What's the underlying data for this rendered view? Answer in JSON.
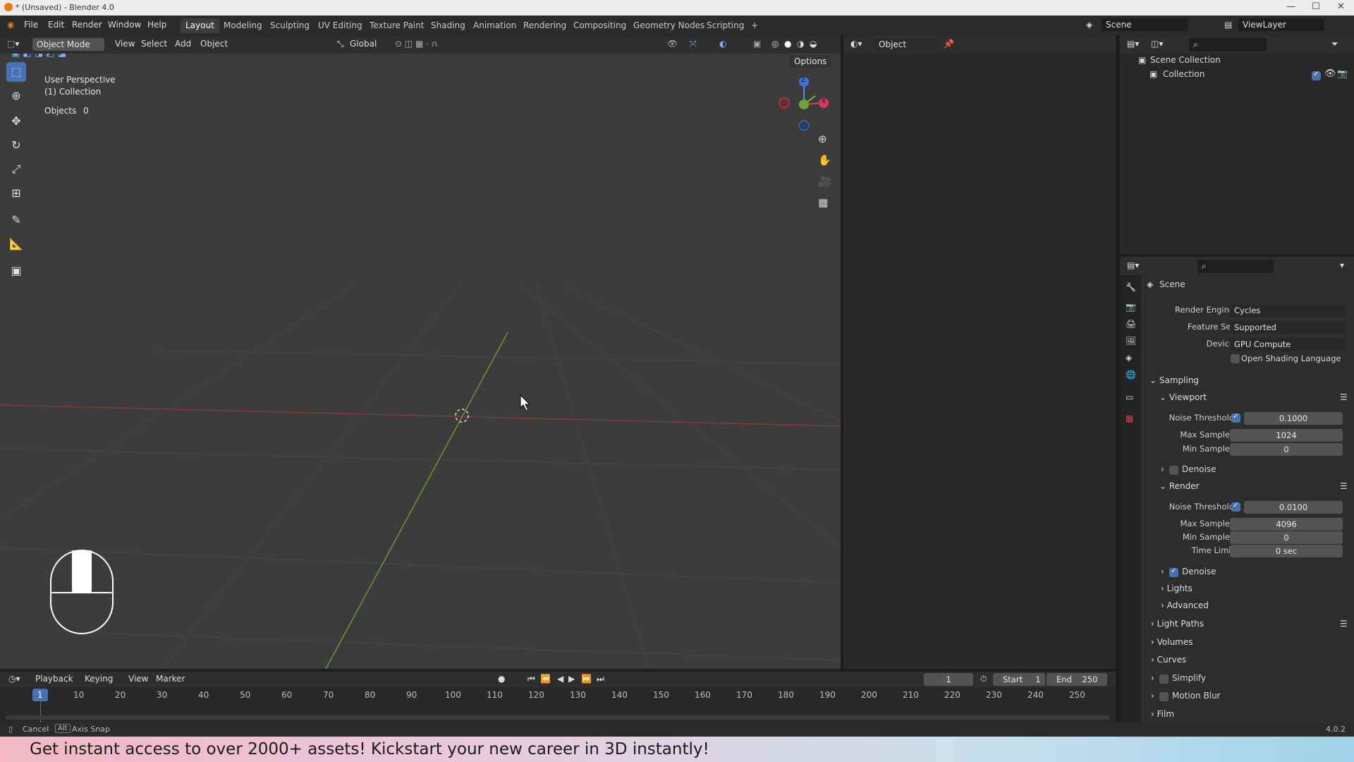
{
  "window": {
    "title": "* (Unsaved) - Blender 4.0",
    "controls": [
      "—",
      "☐",
      "✕"
    ]
  },
  "menu": [
    "File",
    "Edit",
    "Render",
    "Window",
    "Help"
  ],
  "workspaces": [
    "Layout",
    "Modeling",
    "Sculpting",
    "UV Editing",
    "Texture Paint",
    "Shading",
    "Animation",
    "Rendering",
    "Compositing",
    "Geometry Nodes",
    "Scripting",
    "+"
  ],
  "scene": {
    "name": "Scene",
    "view_layer": "ViewLayer"
  },
  "viewport": {
    "mode": "Object Mode",
    "menus": [
      "View",
      "Select",
      "Add",
      "Object"
    ],
    "transform": "Global",
    "options": "Options",
    "overlay_title": "User Perspective",
    "overlay_collection": "(1) Collection",
    "objects_label": "Objects",
    "objects_count": "0",
    "gizmo": {
      "z": "Z",
      "x": "X"
    }
  },
  "editor2": {
    "object_label": "Object"
  },
  "outliner": {
    "root": "Scene Collection",
    "child": "Collection"
  },
  "properties": {
    "header": "Scene",
    "render_engine_label": "Render Engine",
    "render_engine": "Cycles",
    "feature_set_label": "Feature Set",
    "feature_set": "Supported",
    "device_label": "Device",
    "device": "GPU Compute",
    "osl_label": "Open Shading Language",
    "sampling": "Sampling",
    "viewport": "Viewport",
    "noise_threshold_label": "Noise Threshold",
    "max_samples_label": "Max Samples",
    "min_samples_label": "Min Samples",
    "time_limit_label": "Time Limit",
    "vp_noise": "0.1000",
    "vp_max": "1024",
    "vp_min": "0",
    "denoise": "Denoise",
    "render": "Render",
    "r_noise": "0.0100",
    "r_max": "4096",
    "r_min": "0",
    "r_time": "0 sec",
    "lights": "Lights",
    "advanced": "Advanced",
    "light_paths": "Light Paths",
    "volumes": "Volumes",
    "curves": "Curves",
    "simplify": "Simplify",
    "motion_blur": "Motion Blur",
    "film": "Film"
  },
  "timeline": {
    "menus": [
      "Playback",
      "Keying",
      "View",
      "Marker"
    ],
    "current_frame": "1",
    "start_label": "Start",
    "start": "1",
    "end_label": "End",
    "end": "250",
    "ticks": [
      "1",
      "10",
      "20",
      "30",
      "40",
      "50",
      "60",
      "70",
      "80",
      "90",
      "100",
      "110",
      "120",
      "130",
      "140",
      "150",
      "160",
      "170",
      "180",
      "190",
      "200",
      "210",
      "220",
      "230",
      "240",
      "250"
    ]
  },
  "status": {
    "cancel": "Cancel",
    "alt": "Alt",
    "axis_snap": "Axis Snap",
    "version": "4.0.2"
  },
  "banner": {
    "text": "Get instant access to over 2000+ assets! Kickstart your new career in 3D instantly!"
  }
}
